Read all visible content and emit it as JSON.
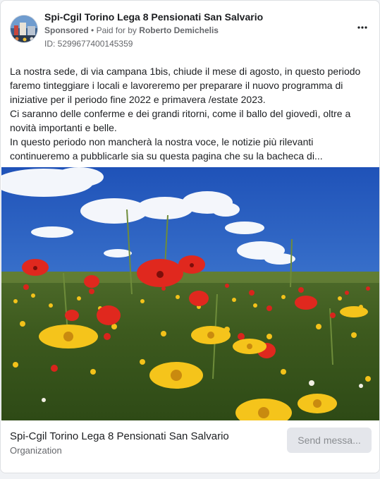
{
  "post": {
    "page_name": "Spi-Cgil Torino Lega 8 Pensionati San Salvario",
    "sponsored_label": "Sponsored",
    "separator": "•",
    "paid_for_prefix": "Paid for by",
    "paid_for_name": "Roberto Demichelis",
    "ad_id": "ID: 5299677400145359",
    "more_icon": "more-horizontal-icon",
    "body_lines": [
      "La nostra sede, di via campana 1bis, chiude il mese di agosto, in questo periodo faremo tinteggiare i locali e lavoreremo per preparare il nuovo programma di iniziative per il periodo fine 2022 e primavera /estate 2023.",
      "Ci saranno delle conferme e dei grandi ritorni, come il ballo del giovedì, oltre a novità importanti e belle.",
      "In questo periodo non mancherà la nostra voce, le notizie più rilevanti continueremo a pubblicarle sia su questa pagina che su la bacheca di..."
    ]
  },
  "footer": {
    "title": "Spi-Cgil Torino Lega 8 Pensionati San Salvario",
    "subtitle": "Organization",
    "button_label": "Send messa..."
  },
  "colors": {
    "text_primary": "#1c1e21",
    "text_secondary": "#65676b",
    "button_bg": "#e4e6eb",
    "button_text": "#8a8d91"
  }
}
